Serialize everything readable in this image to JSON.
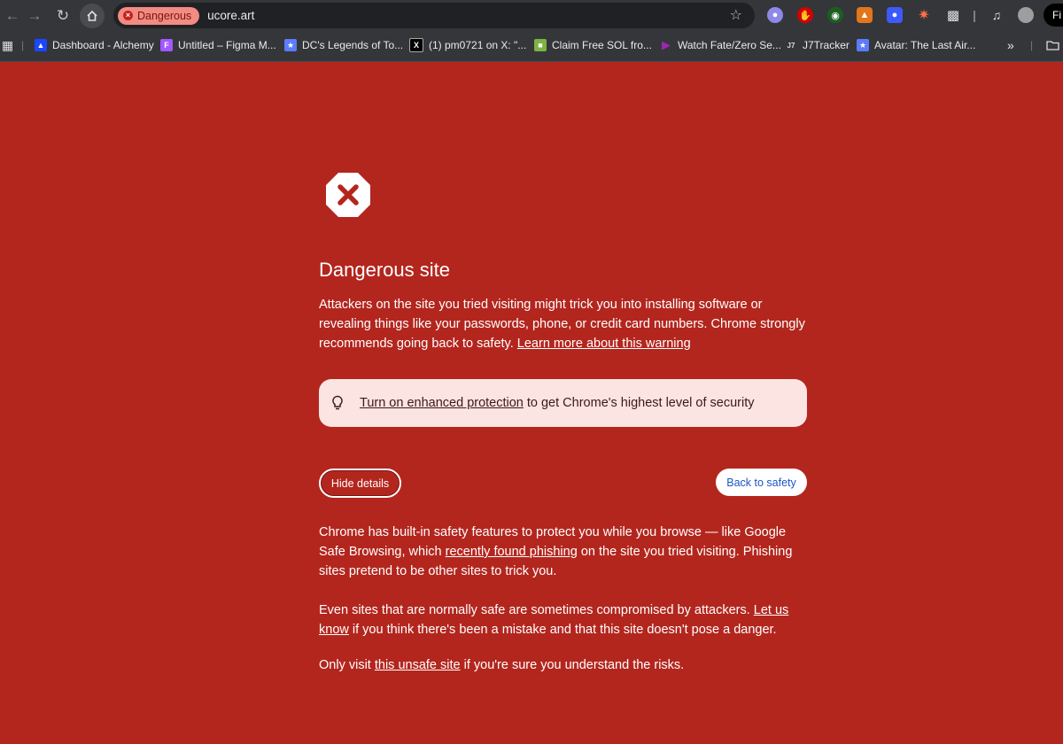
{
  "toolbar": {
    "back_icon": "back-arrow-icon",
    "forward_icon": "forward-arrow-icon",
    "reload_icon": "reload-icon",
    "home_icon": "home-icon",
    "security_chip": "Dangerous",
    "url": "ucore.art",
    "profile_text": "Fi"
  },
  "bookmarks": [
    {
      "label": "Dashboard - Alchemy",
      "icon": "alchemy-icon"
    },
    {
      "label": "Untitled – Figma M...",
      "icon": "figma-icon"
    },
    {
      "label": "DC's Legends of To...",
      "icon": "site-icon"
    },
    {
      "label": "(1) pm0721 on X: \"...",
      "icon": "x-icon"
    },
    {
      "label": "Claim Free SOL fro...",
      "icon": "site-icon"
    },
    {
      "label": "Watch Fate/Zero Se...",
      "icon": "play-icon"
    },
    {
      "label": "J7Tracker",
      "icon": "j7-icon"
    },
    {
      "label": "Avatar: The Last Air...",
      "icon": "site-icon"
    }
  ],
  "page": {
    "title": "Dangerous site",
    "intro": "Attackers on the site you tried visiting might trick you into installing software or revealing things like your passwords, phone, or credit card numbers. Chrome strongly recommends going back to safety.",
    "learn_more_link": "Learn more about this warning",
    "enhanced_link": "Turn on enhanced protection",
    "enhanced_text": "to get Chrome's highest level of security",
    "hide_details_label": "Hide details",
    "back_to_safety_label": "Back to safety",
    "details1_a": "Chrome has built-in safety features to protect you while you browse — like Google Safe Browsing, which",
    "details1_link": "recently found phishing",
    "details1_b": "on the site you tried visiting. Phishing sites pretend to be other sites to trick you.",
    "details2_a": "Even sites that are normally safe are sometimes compromised by attackers.",
    "details2_link": "Let us know",
    "details2_b": "if you think there's been a mistake and that this site doesn't pose a danger.",
    "details3_a": "Only visit",
    "details3_link": "this unsafe site",
    "details3_b": "if you're sure you understand the risks."
  },
  "colors": {
    "page_bg": "#b3261e",
    "chip_bg": "#f28b82",
    "enhanced_bg": "#fce4e2",
    "link_blue": "#1a57c4"
  }
}
